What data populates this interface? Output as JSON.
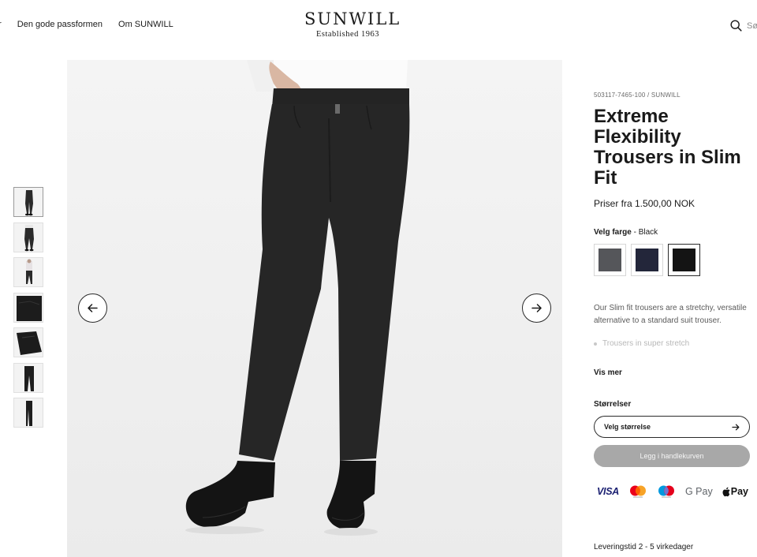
{
  "header": {
    "nav": [
      {
        "label": "er"
      },
      {
        "label": "Den gode passformen"
      },
      {
        "label": "Om SUNWILL"
      }
    ],
    "logo_main": "SUNWILL",
    "logo_sub": "Established 1963",
    "search_label": "Sø"
  },
  "gallery": {
    "thumbnail_count": 7,
    "active_thumbnail": 1
  },
  "product": {
    "sku_line": "503117-7465-100 / SUNWILL",
    "title": "Extreme Flexibility Trousers in Slim Fit",
    "price": "Priser fra 1.500,00 NOK",
    "color_label": "Velg farge",
    "color_separator": " - ",
    "color_selected": "Black",
    "colors": [
      {
        "name": "Grey",
        "hex": "#55565a"
      },
      {
        "name": "Navy",
        "hex": "#23263a"
      },
      {
        "name": "Black",
        "hex": "#141414"
      }
    ],
    "description": "Our Slim fit trousers are a stretchy, versatile alternative to a standard suit trouser.",
    "bullet": "Trousers in super stretch",
    "show_more": "Vis mer",
    "sizes_label": "Størrelser",
    "size_select": "Velg størrelse",
    "add_to_cart": "Legg i handlekurven",
    "payments": [
      "VISA",
      "G Pay",
      "Pay"
    ],
    "delivery": "Leveringstid 2 - 5 virkedager"
  },
  "icons": {
    "search": "search-icon",
    "prev": "arrow-left-icon",
    "next": "arrow-right-icon",
    "size_arrow": "arrow-right-icon"
  }
}
